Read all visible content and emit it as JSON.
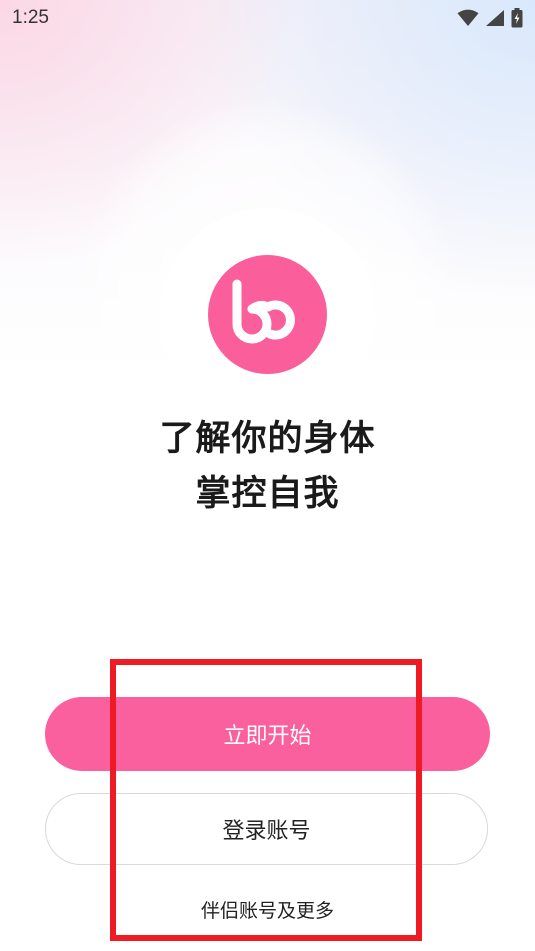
{
  "status_bar": {
    "time": "1:25",
    "icons": [
      "wifi-icon",
      "cell-signal-icon",
      "battery-charging-icon"
    ]
  },
  "logo": {
    "name": "bb-logo-icon",
    "color": "#fa5f9c"
  },
  "headline": {
    "line1": "了解你的身体",
    "line2": "掌控自我"
  },
  "actions": {
    "start_label": "立即开始",
    "login_label": "登录账号",
    "more_label": "伴侣账号及更多"
  },
  "colors": {
    "accent": "#fa5f9e",
    "highlight": "#ee1b24"
  }
}
